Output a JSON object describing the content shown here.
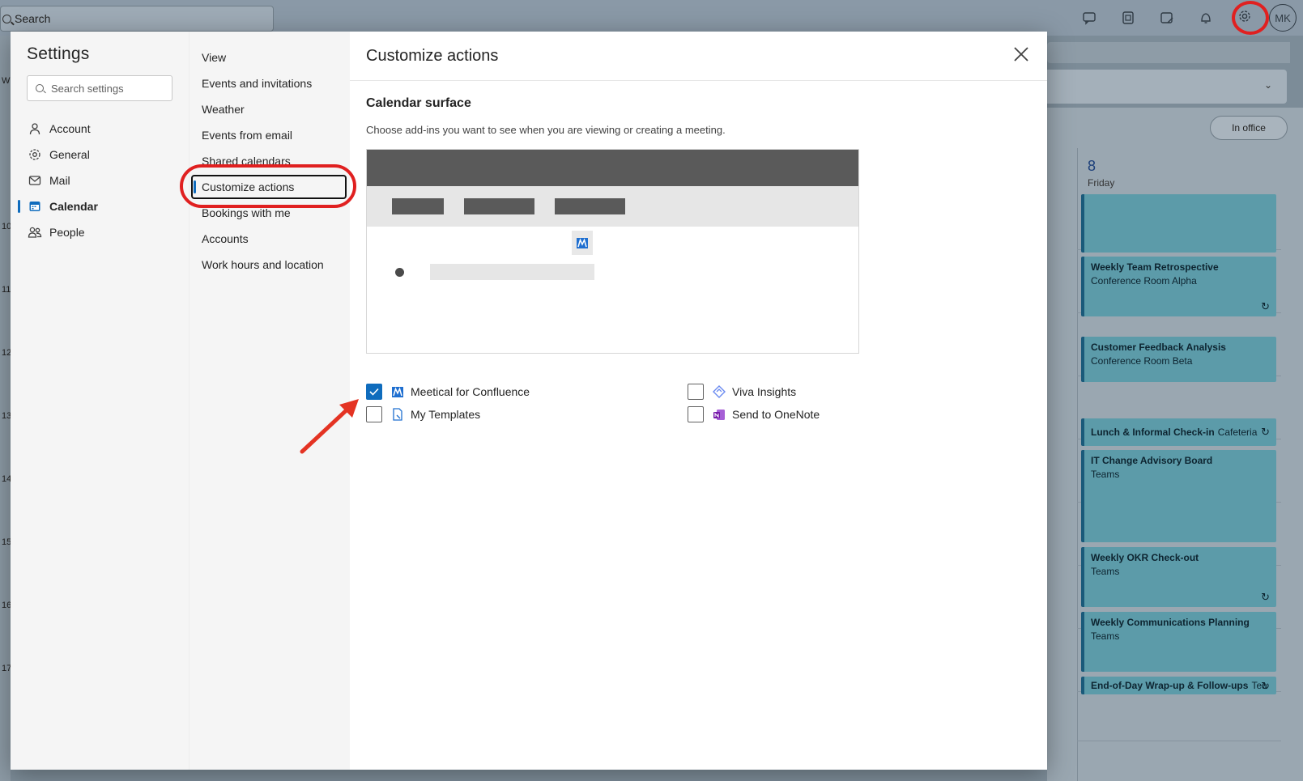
{
  "topbar": {
    "search_placeholder": "Search",
    "avatar_initials": "MK"
  },
  "background": {
    "in_office_label": "In office",
    "day_number": "8",
    "day_name": "Friday",
    "hour_ticks": [
      "10",
      "11",
      "12",
      "13",
      "14",
      "15",
      "16",
      "17"
    ],
    "left_partial": "W",
    "events": [
      {
        "title": "Weekly Team Retrospective",
        "location": "Conference Room Alpha",
        "recurring": true
      },
      {
        "title": "Customer Feedback Analysis",
        "location": "Conference Room Beta",
        "recurring": false
      },
      {
        "title": "Lunch & Informal Check-in",
        "location": "Cafeteria",
        "recurring": false
      },
      {
        "title": "IT Change Advisory Board",
        "location": "Teams",
        "recurring": false
      },
      {
        "title": "Weekly OKR Check-out",
        "location": "Teams",
        "recurring": true
      },
      {
        "title": "Weekly Communications Planning",
        "location": "Teams",
        "recurring": false
      },
      {
        "title": "End-of-Day Wrap-up & Follow-ups",
        "location": "Tea",
        "recurring": true
      }
    ]
  },
  "settings": {
    "title": "Settings",
    "search_placeholder": "Search settings",
    "nav": [
      {
        "label": "Account",
        "icon": "person-icon"
      },
      {
        "label": "General",
        "icon": "gear-icon"
      },
      {
        "label": "Mail",
        "icon": "mail-icon"
      },
      {
        "label": "Calendar",
        "icon": "calendar-icon",
        "active": true
      },
      {
        "label": "People",
        "icon": "people-icon"
      }
    ],
    "subnav": [
      {
        "label": "View"
      },
      {
        "label": "Events and invitations"
      },
      {
        "label": "Weather"
      },
      {
        "label": "Events from email"
      },
      {
        "label": "Shared calendars"
      },
      {
        "label": "Customize actions",
        "active": true
      },
      {
        "label": "Bookings with me"
      },
      {
        "label": "Accounts"
      },
      {
        "label": "Work hours and location"
      }
    ]
  },
  "panel": {
    "title": "Customize actions",
    "section_title": "Calendar surface",
    "section_desc": "Choose add-ins you want to see when you are viewing or creating a meeting.",
    "addins": [
      {
        "label": "Meetical for Confluence",
        "checked": true,
        "icon": "meetical-icon"
      },
      {
        "label": "My Templates",
        "checked": false,
        "icon": "template-icon"
      },
      {
        "label": "Viva Insights",
        "checked": false,
        "icon": "viva-insights-icon"
      },
      {
        "label": "Send to OneNote",
        "checked": false,
        "icon": "onenote-icon"
      }
    ]
  },
  "colors": {
    "accent": "#0f6cbd",
    "highlight": "#e02020",
    "event_fill": "#5c9ba9"
  }
}
